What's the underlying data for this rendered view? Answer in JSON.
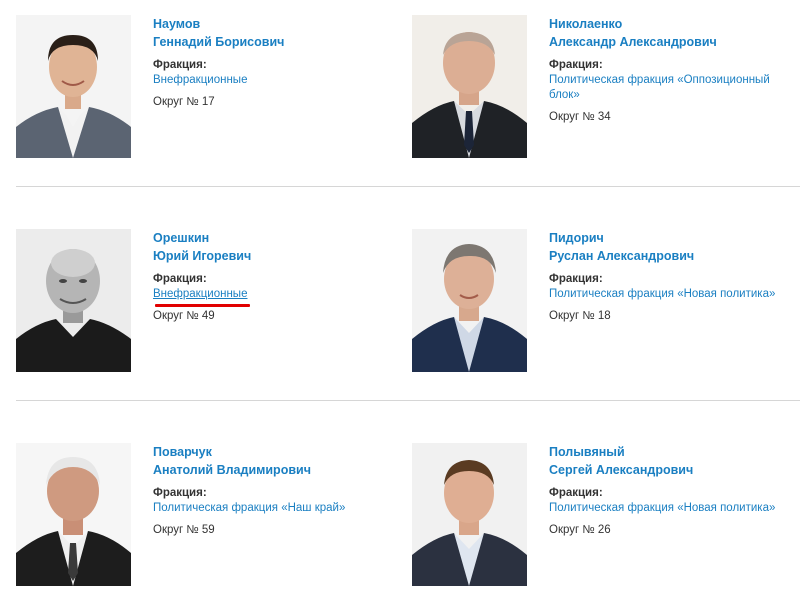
{
  "deputies": [
    {
      "last": "Наумов",
      "first": "Геннадий Борисович",
      "faction_label": "Фракция:",
      "faction": "Внефракционные",
      "district": "Округ № 17"
    },
    {
      "last": "Николаенко",
      "first": "Александр Александрович",
      "faction_label": "Фракция:",
      "faction": "Политическая фракция «Оппозиционный блок»",
      "district": "Округ № 34"
    },
    {
      "last": "Орешкин",
      "first": "Юрий Игоревич",
      "faction_label": "Фракция:",
      "faction": "Внефракционные",
      "district": "Округ № 49"
    },
    {
      "last": "Пидорич",
      "first": "Руслан Александрович",
      "faction_label": "Фракция:",
      "faction": "Политическая фракция «Новая политика»",
      "district": "Округ № 18"
    },
    {
      "last": "Поварчук",
      "first": "Анатолий Владимирович",
      "faction_label": "Фракция:",
      "faction": "Политическая фракция «Наш край»",
      "district": "Округ № 59"
    },
    {
      "last": "Полывяный",
      "first": "Сергей Александрович",
      "faction_label": "Фракция:",
      "faction": "Политическая фракция «Новая политика»",
      "district": "Округ № 26"
    }
  ],
  "colors": {
    "link": "#1a7fc2",
    "text": "#333333",
    "divider": "#d6d6d6",
    "highlight": "#e10000"
  }
}
